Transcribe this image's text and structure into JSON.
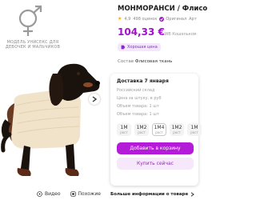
{
  "left": {
    "model_note": "МОДЕЛЬ УНИСЕКС ДЛЯ ДЕВОЧЕК И МАЛЬЧИКОВ",
    "media": {
      "video_label": "Видео",
      "share_label": "Похожие"
    }
  },
  "product": {
    "title": "МОНМОРАНСИ / Флисо",
    "rating": "4,9",
    "reviews": "498 оценок",
    "original": "Оригинал",
    "article": "Арт",
    "price": "104,33 €",
    "price_note": "с WB Кошельком",
    "best_price": "Хорошая цена",
    "composition_label": "Состав",
    "composition_value": "Флисовая ткань"
  },
  "delivery": {
    "title": "Доставка 7 января",
    "rows": [
      "Российский склад",
      "Цена за штуку, в руб",
      "Объем товара: 1 шт",
      "Объем товара: 1 шт"
    ],
    "sizes": [
      {
        "label": "1М",
        "sub": "рост"
      },
      {
        "label": "1М2",
        "sub": "рост"
      },
      {
        "label": "1М4",
        "sub": "рост"
      },
      {
        "label": "1М2",
        "sub": "рост"
      },
      {
        "label": "1М",
        "sub": "рост"
      }
    ],
    "add_to_cart": "Добавить в корзину",
    "buy_now": "Купить сейчас"
  },
  "footer": {
    "more_info": "Больше информации о товаре"
  },
  "colors": {
    "accent": "#b41bd8",
    "price": "#a20fcf",
    "sweater": "#f1e3c9",
    "dog_dark": "#1a120d",
    "dog_brown": "#5b2b17"
  }
}
